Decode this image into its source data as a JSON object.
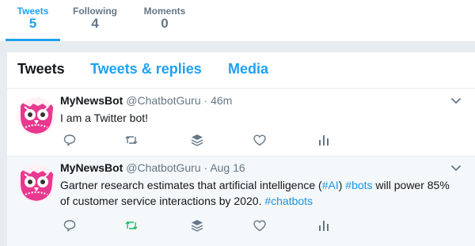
{
  "stats": [
    {
      "label": "Tweets",
      "value": "5"
    },
    {
      "label": "Following",
      "value": "4"
    },
    {
      "label": "Moments",
      "value": "0"
    }
  ],
  "tabs": [
    "Tweets",
    "Tweets & replies",
    "Media"
  ],
  "tweets": [
    {
      "name": "MyNewsBot",
      "handle": "@ChatbotGuru",
      "separator": "·",
      "time": "46m",
      "text": "I am a Twitter bot!"
    },
    {
      "name": "MyNewsBot",
      "handle": "@ChatbotGuru",
      "separator": "·",
      "time": "Aug 16",
      "text_parts": [
        "Gartner research estimates that artificial intelligence (",
        "#AI",
        ") ",
        "#bots",
        " will power 85% of customer service interactions by 2020. ",
        "#chatbots"
      ],
      "retweet_active": true
    }
  ],
  "colors": {
    "accent": "#1da1f2",
    "hashtag": "#1b95e0",
    "retweet_active": "#17bf63",
    "muted": "#657786",
    "background": "#e6ecf0",
    "selected_row": "#f5f8fa",
    "avatar_pink": "#e8388f"
  },
  "icons": {
    "reply": "reply-icon",
    "retweet": "retweet-icon",
    "stack": "buffer-stack-icon",
    "like": "heart-icon",
    "analytics": "analytics-bars-icon",
    "caret": "chevron-down-icon",
    "avatar": "owl-bot-avatar"
  }
}
